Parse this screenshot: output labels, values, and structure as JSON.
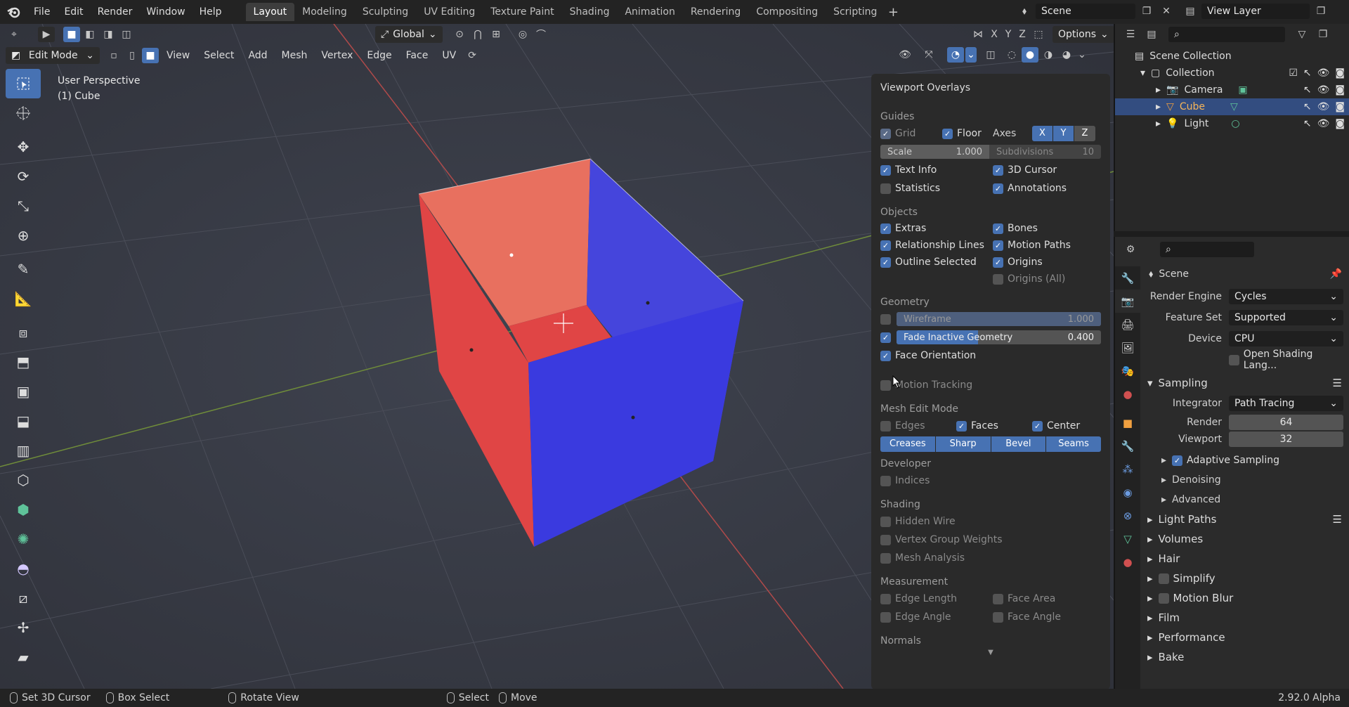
{
  "topbar": {
    "menus": [
      "File",
      "Edit",
      "Render",
      "Window",
      "Help"
    ],
    "workspaces": [
      "Layout",
      "Modeling",
      "Sculpting",
      "UV Editing",
      "Texture Paint",
      "Shading",
      "Animation",
      "Rendering",
      "Compositing",
      "Scripting"
    ],
    "active_workspace": "Layout",
    "scene": "Scene",
    "view_layer": "View Layer"
  },
  "viewport": {
    "mode": "Edit Mode",
    "menus": [
      "View",
      "Select",
      "Add",
      "Mesh",
      "Vertex",
      "Edge",
      "Face",
      "UV"
    ],
    "orientation": "Global",
    "xyz": [
      "X",
      "Y",
      "Z"
    ],
    "options": "Options",
    "perspective": "User Perspective",
    "object": "(1) Cube"
  },
  "overlays": {
    "title": "Viewport Overlays",
    "guides": {
      "label": "Guides",
      "grid": "Grid",
      "floor": "Floor",
      "axes": "Axes",
      "axis_x": "X",
      "axis_y": "Y",
      "axis_z": "Z",
      "scale_label": "Scale",
      "scale_value": "1.000",
      "subdiv_label": "Subdivisions",
      "subdiv_value": "10",
      "text_info": "Text Info",
      "cursor": "3D Cursor",
      "statistics": "Statistics",
      "annotations": "Annotations"
    },
    "objects": {
      "label": "Objects",
      "extras": "Extras",
      "bones": "Bones",
      "relationship": "Relationship Lines",
      "motion_paths": "Motion Paths",
      "outline": "Outline Selected",
      "origins": "Origins",
      "origins_all": "Origins (All)"
    },
    "geometry": {
      "label": "Geometry",
      "wireframe": "Wireframe",
      "wireframe_value": "1.000",
      "wireframe_fraction": 1.0,
      "fade": "Fade Inactive Geometry",
      "fade_value": "0.400",
      "fade_fraction": 0.4,
      "face_orientation": "Face Orientation",
      "motion_tracking": "Motion Tracking"
    },
    "mesh_edit": {
      "label": "Mesh Edit Mode",
      "edges": "Edges",
      "faces": "Faces",
      "center": "Center",
      "buttons": [
        "Creases",
        "Sharp",
        "Bevel",
        "Seams"
      ]
    },
    "developer": {
      "label": "Developer",
      "indices": "Indices"
    },
    "shading": {
      "label": "Shading",
      "hidden_wire": "Hidden Wire",
      "vgroup": "Vertex Group Weights",
      "mesh_analysis": "Mesh Analysis"
    },
    "measurement": {
      "label": "Measurement",
      "edge_length": "Edge Length",
      "face_area": "Face Area",
      "edge_angle": "Edge Angle",
      "face_angle": "Face Angle"
    },
    "normals": "Normals"
  },
  "outliner": {
    "root": "Scene Collection",
    "collection": "Collection",
    "items": [
      {
        "name": "Camera",
        "color": "#e0a060"
      },
      {
        "name": "Cube",
        "color": "#f0a040"
      },
      {
        "name": "Light",
        "color": "#e0a060"
      }
    ]
  },
  "properties": {
    "scene": "Scene",
    "render_engine_label": "Render Engine",
    "render_engine": "Cycles",
    "feature_set_label": "Feature Set",
    "feature_set": "Supported",
    "device_label": "Device",
    "device": "CPU",
    "osl": "Open Shading Lang...",
    "sampling": "Sampling",
    "integrator_label": "Integrator",
    "integrator": "Path Tracing",
    "render_label": "Render",
    "render_value": "64",
    "viewport_label": "Viewport",
    "viewport_value": "32",
    "adaptive": "Adaptive Sampling",
    "denoising": "Denoising",
    "advanced": "Advanced",
    "panels": [
      "Light Paths",
      "Volumes",
      "Hair",
      "Simplify",
      "Motion Blur",
      "Film",
      "Performance",
      "Bake"
    ]
  },
  "status": {
    "set_cursor": "Set 3D Cursor",
    "box_select": "Box Select",
    "rotate": "Rotate View",
    "select": "Select",
    "move": "Move",
    "version": "2.92.0 Alpha"
  },
  "colors": {
    "accent": "#4772b3",
    "face_front": "#3a3adf",
    "face_back": "#e04545"
  }
}
